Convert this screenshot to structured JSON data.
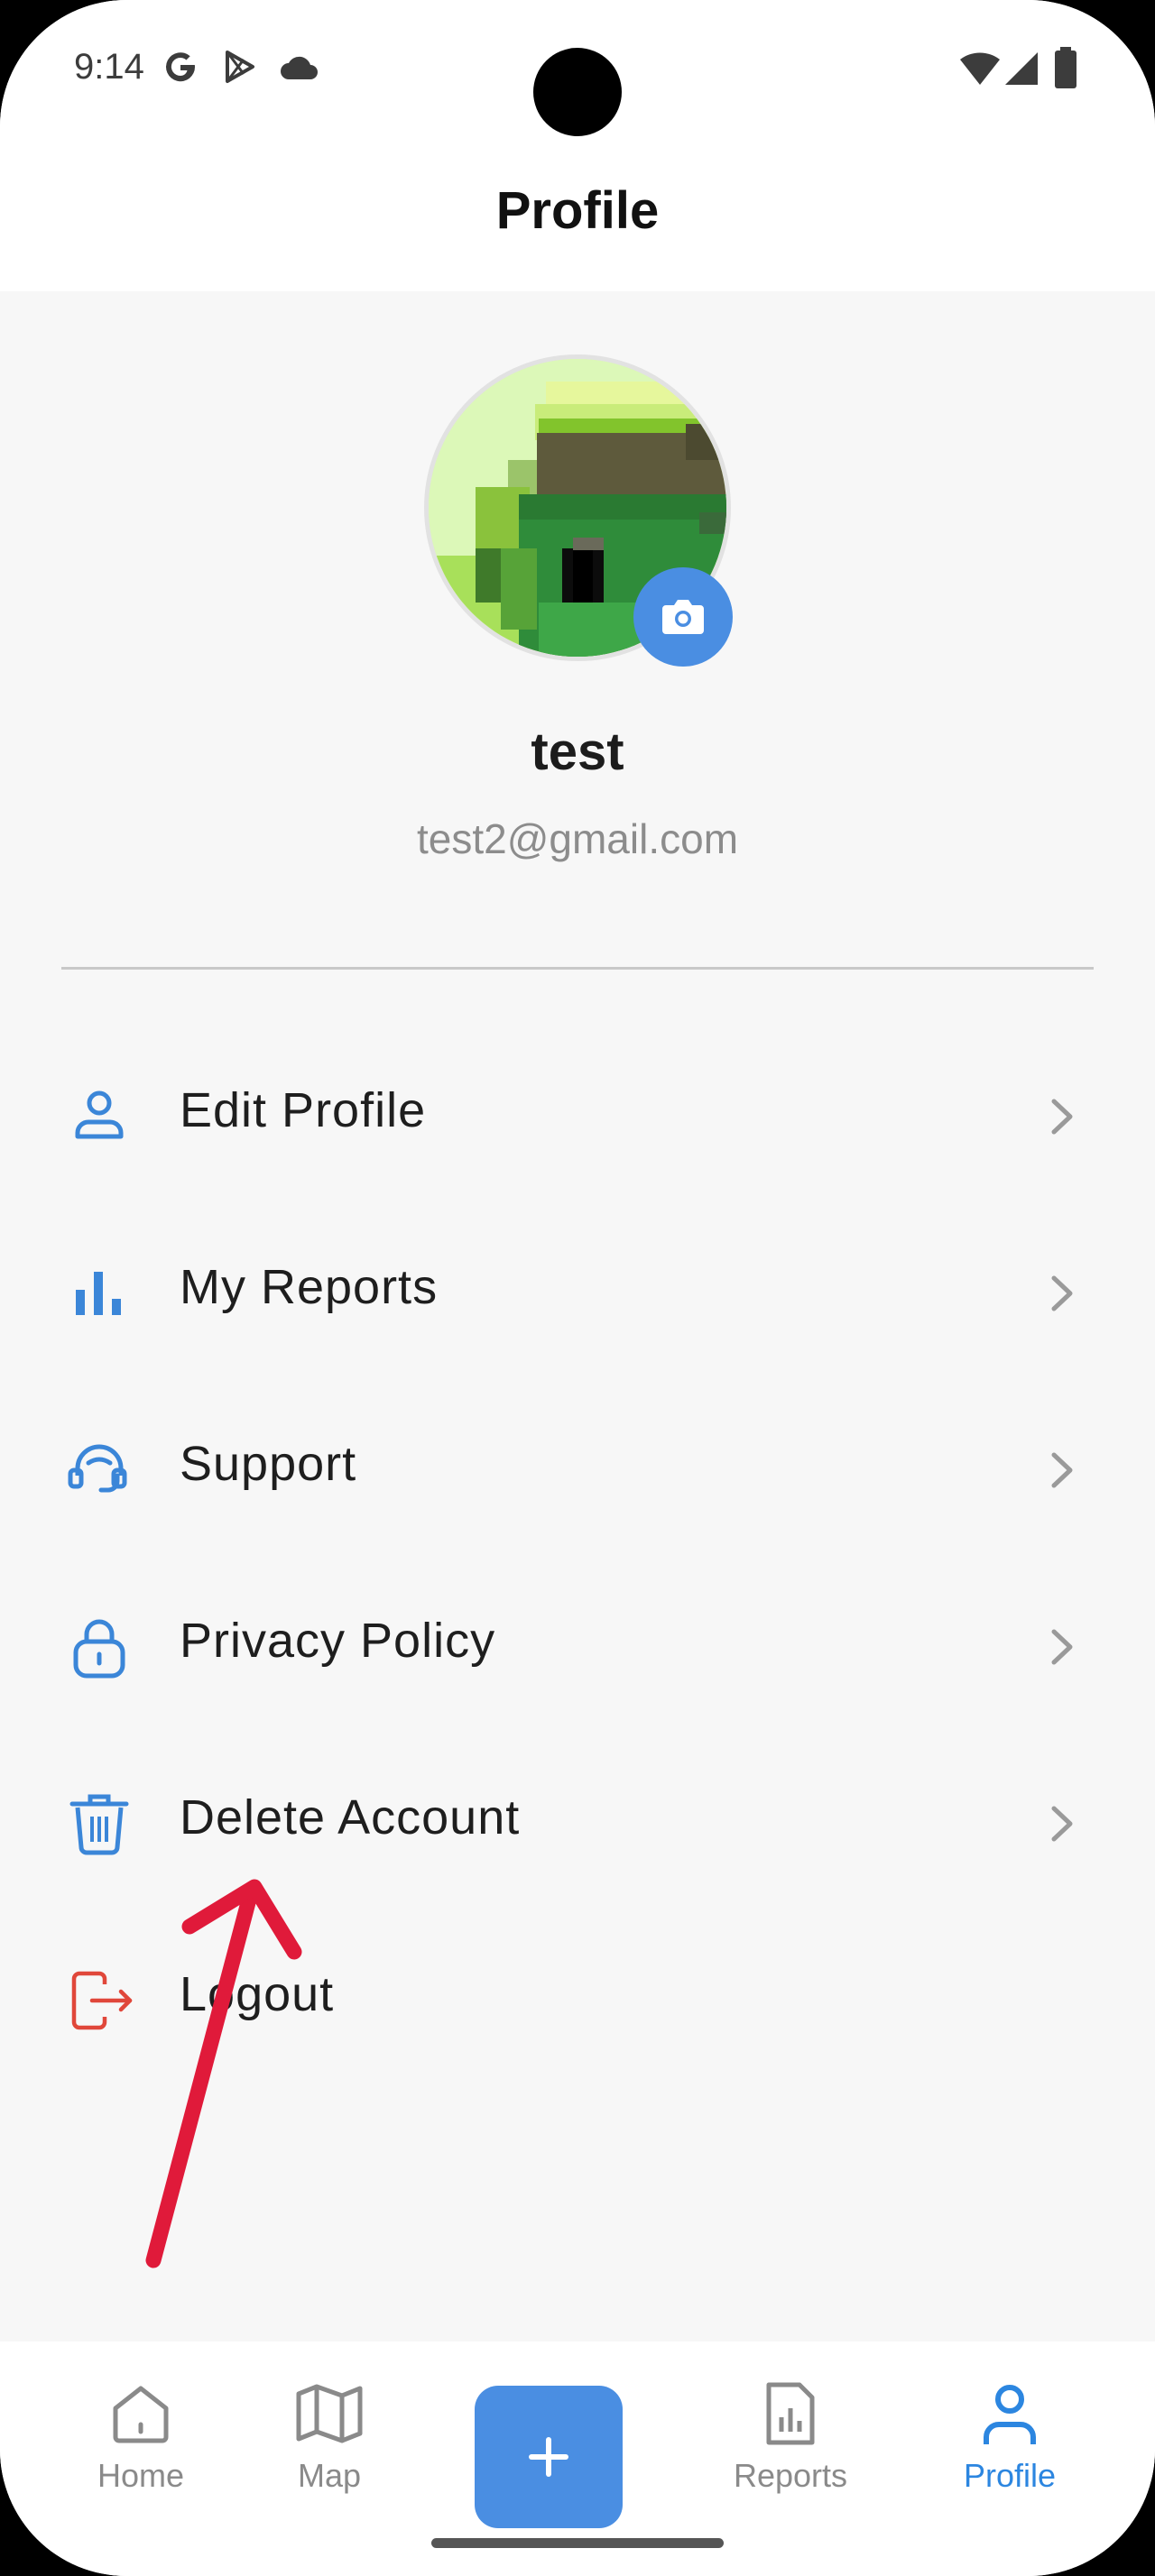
{
  "status_bar": {
    "time": "9:14",
    "left_icons": [
      "google-icon",
      "play-store-icon",
      "cloud-icon"
    ],
    "right_icons": [
      "wifi-icon",
      "signal-icon",
      "battery-icon"
    ]
  },
  "header": {
    "title": "Profile"
  },
  "profile": {
    "name": "test",
    "email": "test2@gmail.com",
    "avatar_icon": "pixel-art-avatar",
    "change_photo_icon": "camera-icon"
  },
  "menu": [
    {
      "label": "Edit Profile",
      "icon": "person-icon"
    },
    {
      "label": "My Reports",
      "icon": "bar-chart-icon"
    },
    {
      "label": "Support",
      "icon": "headset-icon"
    },
    {
      "label": "Privacy Policy",
      "icon": "lock-icon"
    },
    {
      "label": "Delete Account",
      "icon": "trash-icon"
    },
    {
      "label": "Logout",
      "icon": "logout-icon"
    }
  ],
  "bottom_nav": {
    "items": [
      {
        "label": "Home",
        "icon": "home-icon"
      },
      {
        "label": "Map",
        "icon": "map-icon"
      },
      {
        "label": "Reports",
        "icon": "report-icon"
      },
      {
        "label": "Profile",
        "icon": "person-icon"
      }
    ],
    "active": "Profile",
    "fab_icon": "plus-icon"
  },
  "colors": {
    "accent": "#4a8ee2",
    "active_nav": "#2c86e0",
    "logout": "#e0473a",
    "annotation_arrow": "#e01a3a",
    "background": "#f7f7f7"
  }
}
